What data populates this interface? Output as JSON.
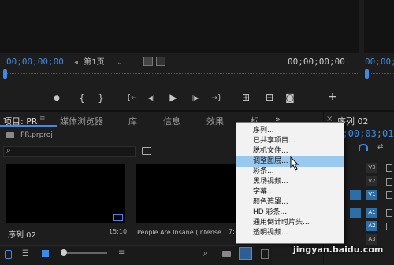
{
  "monitor": {
    "timecode_left": "00;00;00;00",
    "page_selector": "第1页",
    "timecode_right": "00;00;00;00",
    "timecode_far_right": "00;00;0"
  },
  "transport": {
    "marker_icon": "●",
    "in_icon": "{",
    "out_icon": "}",
    "go_in_icon": "{←",
    "step_back_icon": "◀|",
    "play_icon": "▶",
    "step_fwd_icon": "|▶",
    "go_out_icon": "→}",
    "insert_icon": "⊞",
    "overwrite_icon": "⊟",
    "camera_icon": "◙",
    "add_icon": "+"
  },
  "panel_tabs": {
    "project": "项目: PR",
    "media_browser": "媒体浏览器",
    "library": "库",
    "info": "信息",
    "effects": "效果",
    "markers": "标",
    "more": "»"
  },
  "project": {
    "name": "PR.prproj",
    "search_placeholder": "",
    "items": [
      {
        "name": "序列 02",
        "duration": "15:10"
      },
      {
        "name": "People Are Insane (Intense...",
        "duration": "7:"
      }
    ]
  },
  "timeline": {
    "sequence_tab": "序列 02",
    "timecode": "00;00;03;01",
    "tracks": [
      "V3",
      "V2",
      "V1",
      "A1",
      "A2",
      "A3"
    ]
  },
  "context_menu": {
    "items": [
      {
        "label": "序列...",
        "highlighted": false
      },
      {
        "label": "已共享项目...",
        "highlighted": false
      },
      {
        "label": "脱机文件...",
        "highlighted": false
      },
      {
        "label": "调整图层...",
        "highlighted": true
      },
      {
        "label": "彩条...",
        "highlighted": false
      },
      {
        "label": "黑场视频...",
        "highlighted": false
      },
      {
        "label": "字幕...",
        "highlighted": false
      },
      {
        "label": "颜色遮罩...",
        "highlighted": false
      },
      {
        "label": "HD 彩条...",
        "highlighted": false
      },
      {
        "label": "通用倒计时片头...",
        "highlighted": false
      },
      {
        "label": "透明视频...",
        "highlighted": false
      }
    ]
  },
  "watermark": "jingyan.baidu.com",
  "colors": {
    "accent": "#3f8ae6",
    "highlight": "#99c9ef",
    "bg": "#1d1d1d"
  }
}
